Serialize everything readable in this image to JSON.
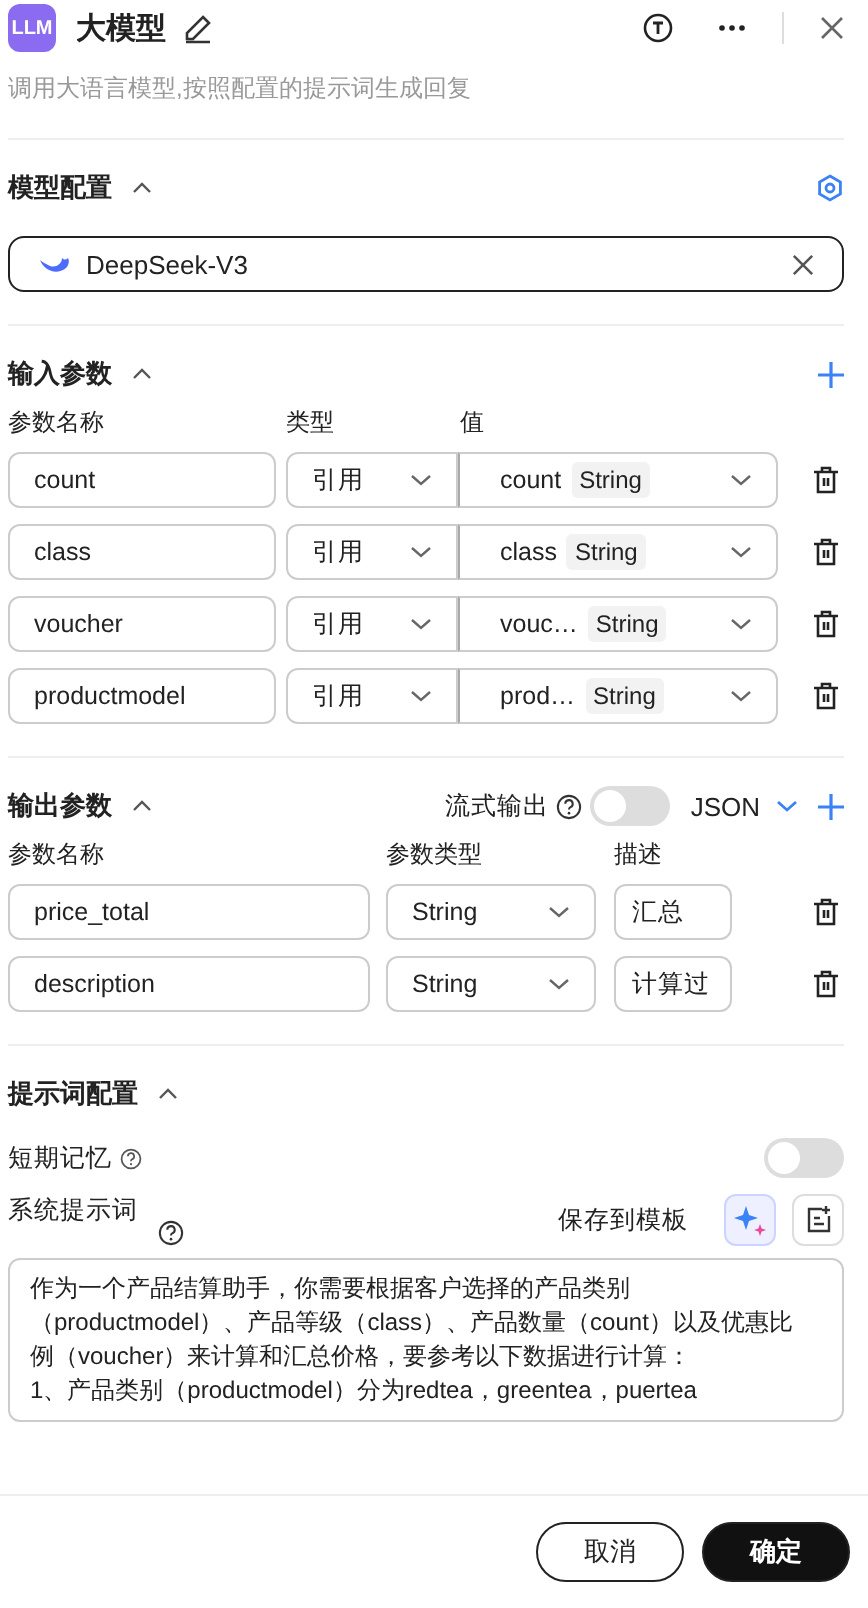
{
  "header": {
    "logo": "LLM",
    "title": "大模型",
    "description": "调用大语言模型,按照配置的提示词生成回复"
  },
  "model_config": {
    "title": "模型配置",
    "expanded": true,
    "model": "DeepSeek-V3"
  },
  "input_params": {
    "title": "输入参数",
    "expanded": true,
    "columns": [
      "参数名称",
      "类型",
      "值"
    ],
    "rows": [
      {
        "name": "count",
        "type": "引用",
        "value": "count",
        "value_type": "String"
      },
      {
        "name": "class",
        "type": "引用",
        "value": "class",
        "value_type": "String"
      },
      {
        "name": "voucher",
        "type": "引用",
        "value": "vouc…",
        "value_type": "String"
      },
      {
        "name": "productmodel",
        "type": "引用",
        "value": "prod…",
        "value_type": "String"
      }
    ]
  },
  "output_params": {
    "title": "输出参数",
    "expanded": true,
    "stream_label": "流式输出",
    "stream_on": false,
    "format": "JSON",
    "columns": [
      "参数名称",
      "参数类型",
      "描述"
    ],
    "rows": [
      {
        "name": "price_total",
        "type": "String",
        "description": "汇总"
      },
      {
        "name": "description",
        "type": "String",
        "description": "计算过"
      }
    ]
  },
  "prompt_config": {
    "title": "提示词配置",
    "expanded": true,
    "memory_label": "短期记忆",
    "memory_on": false,
    "system_label": "系统提示词",
    "save_template": "保存到模板",
    "prompt_lines": [
      "作为一个产品结算助手，你需要根据客户选择的产品类别",
      "（productmodel）、产品等级（class）、产品数量（count）以及优惠比",
      "例（voucher）来计算和汇总价格，要参考以下数据进行计算：",
      "1、产品类别（productmodel）分为redtea，greentea，puertea"
    ]
  },
  "footer": {
    "cancel": "取消",
    "confirm": "确定"
  }
}
